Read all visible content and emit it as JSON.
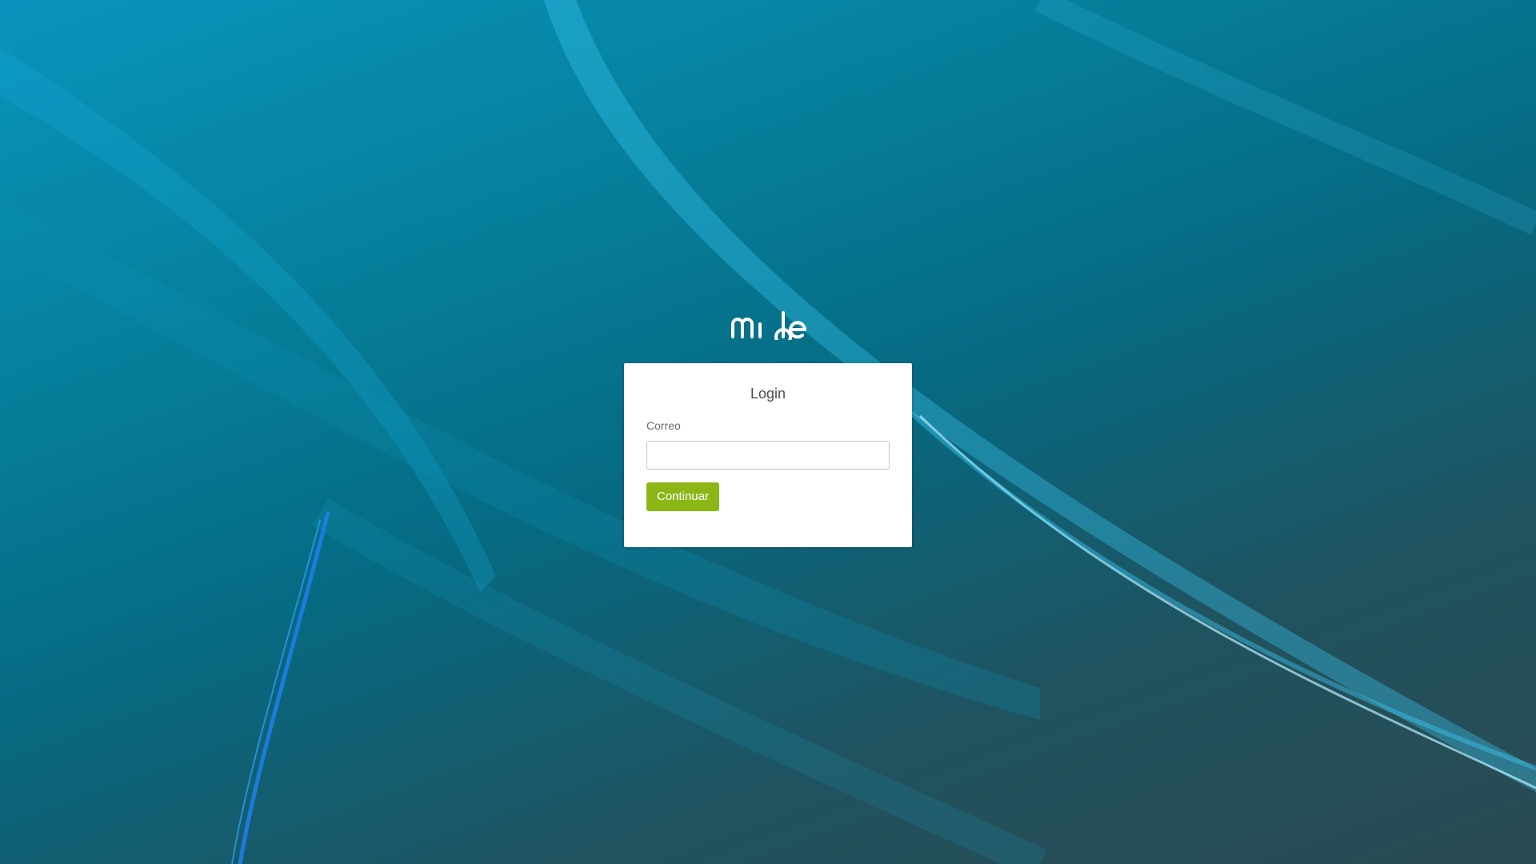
{
  "brand": {
    "logo_text": "mide",
    "logo_color": "#ffffff"
  },
  "login": {
    "title": "Login",
    "email_label": "Correo",
    "email_value": "",
    "email_placeholder": "",
    "submit_label": "Continuar"
  },
  "colors": {
    "button": "#8cb616",
    "background_top": "#0a93bd",
    "background_bottom": "#2b4a52"
  }
}
